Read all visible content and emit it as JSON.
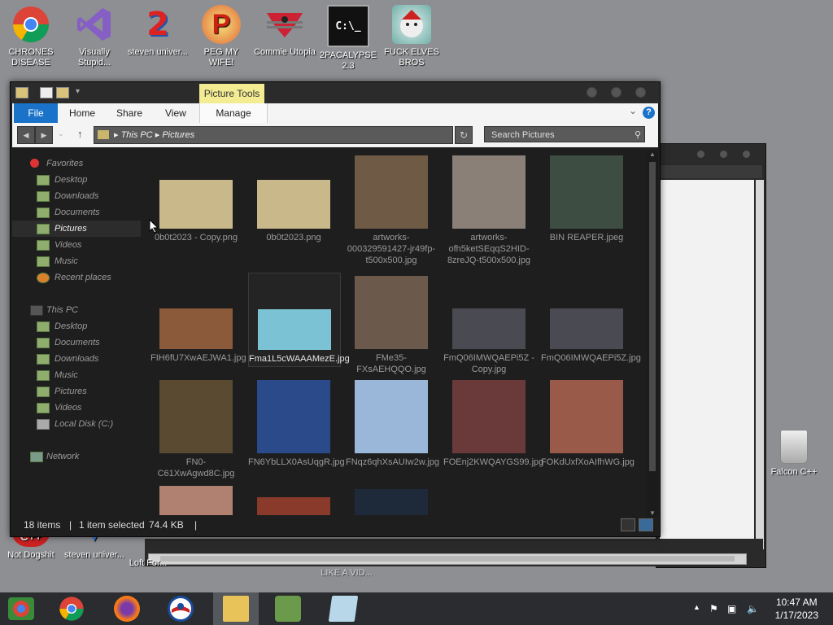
{
  "desktop": {
    "top_icons": [
      {
        "label": "CHRONES DISEASE",
        "icon": "chrome-icon"
      },
      {
        "label": "Visually Stupid...",
        "icon": "visual-studio-icon"
      },
      {
        "label": "steven univer...",
        "icon": "number-2-icon"
      },
      {
        "label": "PEG MY WIFE!",
        "icon": "p-icon"
      },
      {
        "label": "Commie Utopia",
        "icon": "flag-icon"
      },
      {
        "label": "2PACALYPSE 2.3",
        "icon": "cmd-icon"
      },
      {
        "label": "FUCK ELVES BROS",
        "icon": "bros-icon"
      }
    ],
    "bottom_icons": [
      {
        "label": "Not Dogshit",
        "icon": "cpp-icon"
      },
      {
        "label": "steven univer...",
        "icon": "vs-icon"
      },
      {
        "label": "Loft For...",
        "icon": "j-icon"
      },
      {
        "label": "LIKE A VID...",
        "icon": "video-icon"
      }
    ],
    "recycle_bin": {
      "label": "Falcon C++",
      "icon": "recycle-bin-icon"
    }
  },
  "explorer": {
    "context_tab": "Picture Tools",
    "ribbon_tabs": [
      "File",
      "Home",
      "Share",
      "View",
      "Manage"
    ],
    "help": "?",
    "address": {
      "crumbs": [
        "This PC",
        "Pictures"
      ]
    },
    "search_placeholder": "Search Pictures",
    "nav": {
      "favorites": {
        "label": "Favorites",
        "items": [
          "Desktop",
          "Downloads",
          "Documents",
          "Pictures",
          "Videos",
          "Music",
          "Recent places"
        ]
      },
      "this_pc": {
        "label": "This PC",
        "items": [
          "Desktop",
          "Documents",
          "Downloads",
          "Music",
          "Pictures",
          "Videos",
          "Local Disk (C:)"
        ]
      },
      "network": {
        "label": "Network"
      },
      "selected": "Pictures"
    },
    "files": [
      {
        "name": "0b0t2023 - Copy.png",
        "color": "#c9b98a"
      },
      {
        "name": "0b0t2023.png",
        "color": "#c9b98a"
      },
      {
        "name": "artworks-000329591427-jr49fp-t500x500.jpg",
        "color": "#6e5a45"
      },
      {
        "name": "artworks-ofh5ketSEqqS2HID-8zreJQ-t500x500.jpg",
        "color": "#8a8078"
      },
      {
        "name": "BIN REAPER.jpeg",
        "color": "#3e4d42"
      },
      {
        "name": "FIH6fU7XwAEJWA1.jpg",
        "color": "#8a5a3a"
      },
      {
        "name": "Fma1L5cWAAAMezE.jpg",
        "color": "#7bc3d4"
      },
      {
        "name": "FMe35-FXsAEHQQO.jpg",
        "color": "#6b5a4b"
      },
      {
        "name": "FmQ06IMWQAEPi5Z - Copy.jpg",
        "color": "#4a4a52"
      },
      {
        "name": "FmQ06IMWQAEPi5Z.jpg",
        "color": "#4a4a52"
      },
      {
        "name": "FN0-C61XwAgwd8C.jpg",
        "color": "#5a4a32"
      },
      {
        "name": "FN6YbLLX0AsUqgR.jpg",
        "color": "#2b4a8a"
      },
      {
        "name": "FNqz6qhXsAUIw2w.jpg",
        "color": "#9ab6d8"
      },
      {
        "name": "FOEnj2KWQAYGS99.jpg",
        "color": "#6a3a3a"
      },
      {
        "name": "FOKdUxfXoAIfhWG.jpg",
        "color": "#9a5a4a"
      },
      {
        "name": "",
        "color": "#b08070"
      },
      {
        "name": "",
        "color": "#8a3a2a"
      },
      {
        "name": "",
        "color": "#1e2a3a"
      }
    ],
    "selected_file": "Fma1L5cWAAAMezE.jpg",
    "status": {
      "count": "18 items",
      "selected": "1 item selected",
      "size": "74.4 KB"
    }
  },
  "taskbar": {
    "pinned": [
      "chrome-color-icon",
      "chrome-icon",
      "firefox-icon",
      "obama-icon",
      "file-explorer-icon",
      "network-icon",
      "notepad-icon"
    ],
    "clock": {
      "time": "10:47 AM",
      "date": "1/17/2023"
    }
  }
}
